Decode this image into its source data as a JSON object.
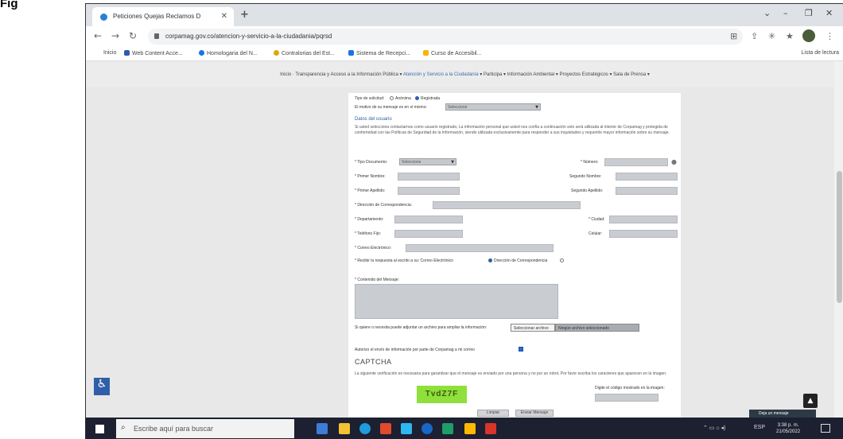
{
  "doc_label": "Fig",
  "browser": {
    "tab_title": "Peticiones Quejas Reclamos D",
    "url": "corpamag.gov.co/atencion-y-servicio-a-la-ciudadania/pqrsd",
    "reading_list": "Lista de lectura",
    "bookmarks": [
      {
        "label": "Inicio",
        "color": "#999999"
      },
      {
        "label": "Web Content Acce...",
        "color": "#2a5db0"
      },
      {
        "label": "Homologaria del N...",
        "color": "#1a73e8"
      },
      {
        "label": "Contralorias del Est...",
        "color": "#e0a800"
      },
      {
        "label": "Sistema de Recepci...",
        "color": "#1a73e8"
      },
      {
        "label": "Curso de Accesibil...",
        "color": "#f4b400"
      }
    ]
  },
  "site_nav": {
    "items": [
      "Inicio",
      "Transparencia y Acceso a la Información Pública",
      "Atención y Servicio a la Ciudadanía",
      "Participa",
      "Información Ambiental",
      "Proyectos Estratégicos",
      "Sala de Prensa"
    ],
    "active_index": 2
  },
  "form": {
    "request_type_label": "Tipo de solicitud:",
    "anonymous_label": "Anónima",
    "registered_label": "Registrada",
    "motive_label": "El motivo de su mensaje es en sí mismo:",
    "motive_value": "Seleccione",
    "user_data_title": "Datos del usuario",
    "user_data_paragraph": "Si usted selecciona contactarnos como usuario registrado, La información personal que usted nos confía a continuación solo será utilizada al interior de Corpamag y protegida de conformidad con las Políticas de Seguridad de la Información, siendo utilizada exclusivamente para responder a sus inquietudes y requerirle mayor información sobre su mensaje.",
    "doc_type_label": "* Tipo Documento:",
    "doc_type_value": "Seleccione",
    "number_label": "* Número:",
    "first_name_label": "* Primer Nombre:",
    "second_name_label": "Segundo Nombre:",
    "first_surname_label": "* Primer Apellido:",
    "second_surname_label": "Segundo Apellido:",
    "address_label": "* Dirección de Correspondencia:",
    "department_label": "* Departamento:",
    "city_label": "* Ciudad:",
    "landline_label": "* Teléfono Fijo:",
    "mobile_label": "Celular:",
    "email_label": "* Correo Electrónico:",
    "response_via_label": "* Recibir la respuesta al escrito a su: Correo Electrónico",
    "response_address_option": "Dirección de Correspondencia",
    "message_label": "* Contenido del Mensaje:",
    "attach_label": "Si quiere o necesita puede adjuntar un archivo para ampliar la información:",
    "file_button": "Seleccionar archivo",
    "file_status": "Ningún archivo seleccionado",
    "consent_label": "Autorizo el envío de información por parte de Corpamag a mi correo",
    "captcha_title": "CAPTCHA",
    "captcha_paragraph": "La siguiente verificación es necesaria para garantizar que el mensaje es enviado por una persona y no por un robot. Por favor escriba los caracteres que aparecen en la imagen.",
    "captcha_code": "TvdZ7F",
    "captcha_prompt": "Digite el código mostrado en la imagen:",
    "clear_button": "Limpiar",
    "submit_button": "Enviar Mensaje"
  },
  "chat_button": "Deja un mensaje",
  "taskbar": {
    "search_placeholder": "Escribe aquí para buscar",
    "clock_time": "3:38 p. m.",
    "clock_date": "21/05/2022",
    "lang": "ESP",
    "app_colors": [
      "#3d7dd8",
      "#f2c232",
      "#1f9bde",
      "#e04b2c",
      "#2fb7f2",
      "#1767c7",
      "#1f9c6a",
      "#ffb900",
      "#d9342b"
    ]
  }
}
